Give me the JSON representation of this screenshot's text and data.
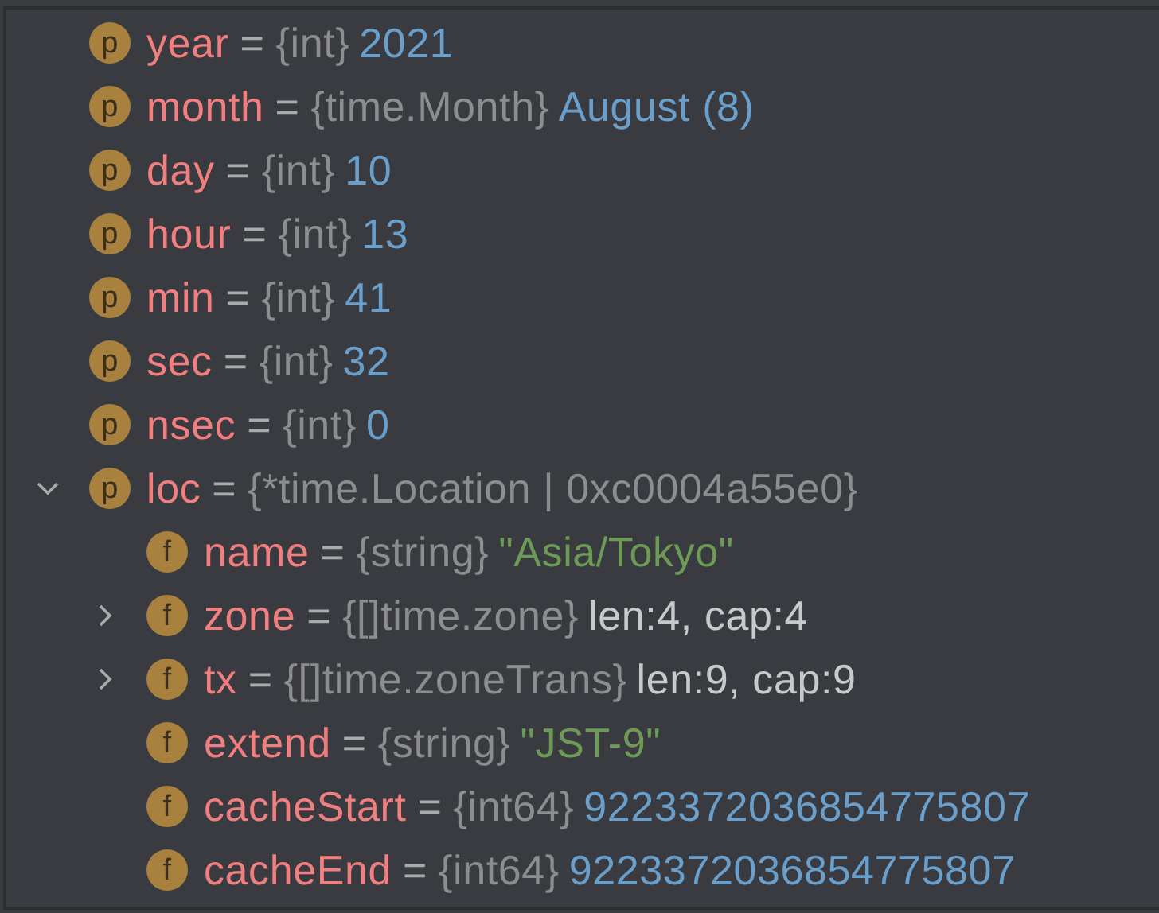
{
  "variables": [
    {
      "badge": "p",
      "name": "year",
      "separator": "=",
      "type": "{int}",
      "value": "2021",
      "kind": "number"
    },
    {
      "badge": "p",
      "name": "month",
      "separator": "=",
      "type": "{time.Month}",
      "value": "August (8)",
      "kind": "number"
    },
    {
      "badge": "p",
      "name": "day",
      "separator": "=",
      "type": "{int}",
      "value": "10",
      "kind": "number"
    },
    {
      "badge": "p",
      "name": "hour",
      "separator": "=",
      "type": "{int}",
      "value": "13",
      "kind": "number"
    },
    {
      "badge": "p",
      "name": "min",
      "separator": "=",
      "type": "{int}",
      "value": "41",
      "kind": "number"
    },
    {
      "badge": "p",
      "name": "sec",
      "separator": "=",
      "type": "{int}",
      "value": "32",
      "kind": "number"
    },
    {
      "badge": "p",
      "name": "nsec",
      "separator": "=",
      "type": "{int}",
      "value": "0",
      "kind": "number"
    },
    {
      "badge": "p",
      "name": "loc",
      "separator": "=",
      "type": "{*time.Location | 0xc0004a55e0}",
      "expanded": true,
      "children": [
        {
          "badge": "f",
          "name": "name",
          "separator": "=",
          "type": "{string}",
          "value": "\"Asia/Tokyo\"",
          "kind": "string"
        },
        {
          "badge": "f",
          "name": "zone",
          "separator": "=",
          "type": "{[]time.zone}",
          "value": "len:4, cap:4",
          "kind": "plain",
          "expanded": false
        },
        {
          "badge": "f",
          "name": "tx",
          "separator": "=",
          "type": "{[]time.zoneTrans}",
          "value": "len:9, cap:9",
          "kind": "plain",
          "expanded": false
        },
        {
          "badge": "f",
          "name": "extend",
          "separator": "=",
          "type": "{string}",
          "value": "\"JST-9\"",
          "kind": "string"
        },
        {
          "badge": "f",
          "name": "cacheStart",
          "separator": "=",
          "type": "{int64}",
          "value": "9223372036854775807",
          "kind": "number"
        },
        {
          "badge": "f",
          "name": "cacheEnd",
          "separator": "=",
          "type": "{int64}",
          "value": "9223372036854775807",
          "kind": "number"
        }
      ]
    }
  ]
}
